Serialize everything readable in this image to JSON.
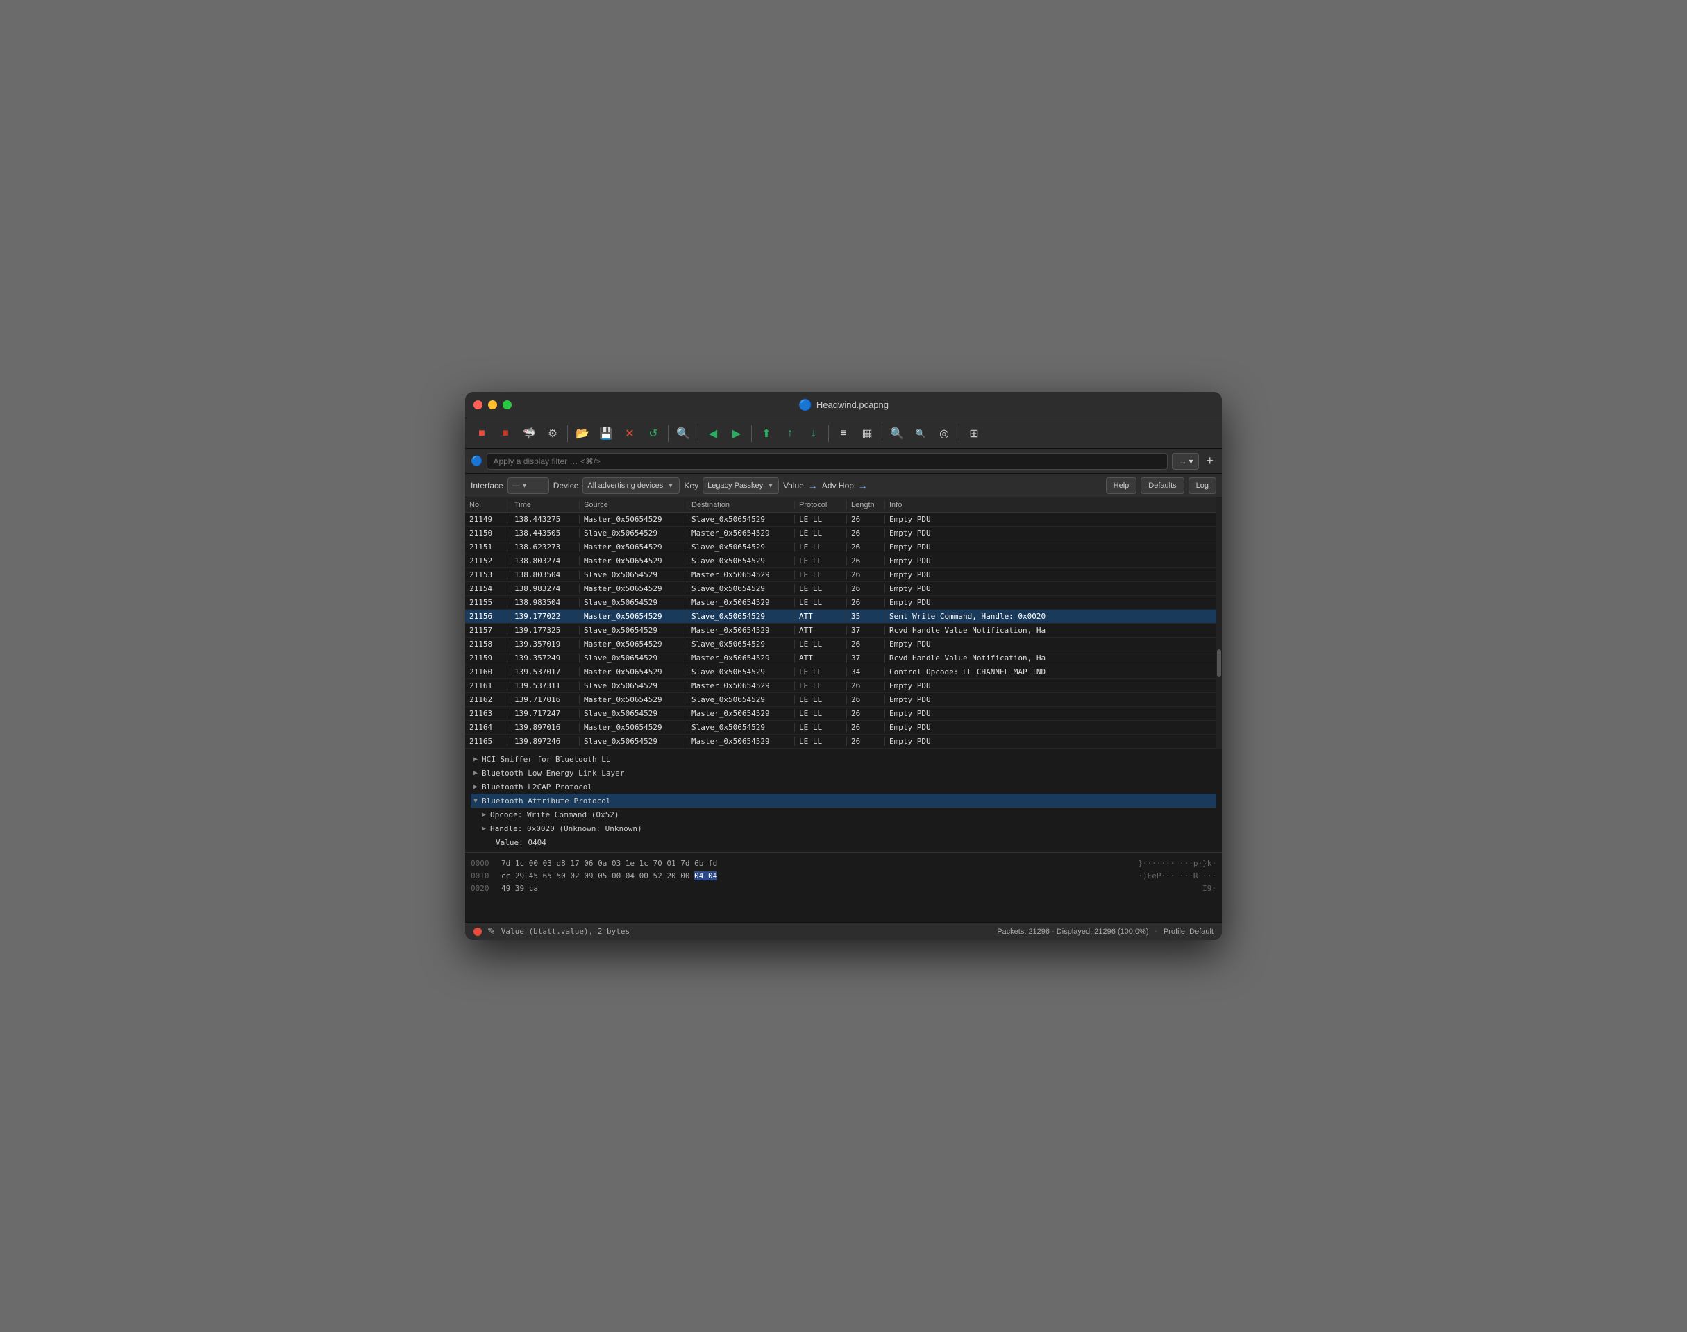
{
  "window": {
    "title": "Headwind.pcapng",
    "title_icon": "🔵"
  },
  "toolbar": {
    "buttons": [
      {
        "name": "stop-capture",
        "icon": "■",
        "class": "stop"
      },
      {
        "name": "start-capture",
        "icon": "▶",
        "class": "green"
      },
      {
        "name": "settings",
        "icon": "⚙",
        "class": ""
      },
      {
        "name": "open-file",
        "icon": "📁",
        "class": "blue"
      },
      {
        "name": "save",
        "icon": "💾",
        "class": ""
      },
      {
        "name": "close",
        "icon": "✕",
        "class": ""
      },
      {
        "name": "reload",
        "icon": "↺",
        "class": ""
      },
      {
        "name": "zoom-in-pkt",
        "icon": "🔍+",
        "class": ""
      },
      {
        "name": "prev",
        "icon": "◀",
        "class": "green"
      },
      {
        "name": "next",
        "icon": "▶",
        "class": "green"
      },
      {
        "name": "go-first",
        "icon": "⏫",
        "class": ""
      },
      {
        "name": "go-up",
        "icon": "⬆",
        "class": "green"
      },
      {
        "name": "go-down",
        "icon": "⬇",
        "class": "green"
      },
      {
        "name": "list-view",
        "icon": "≡",
        "class": ""
      },
      {
        "name": "columns",
        "icon": "⊞",
        "class": ""
      },
      {
        "name": "zoom-in",
        "icon": "+🔍",
        "class": ""
      },
      {
        "name": "zoom-out",
        "icon": "🔍-",
        "class": ""
      },
      {
        "name": "zoom-reset",
        "icon": "◎",
        "class": ""
      },
      {
        "name": "stats",
        "icon": "▦",
        "class": ""
      }
    ]
  },
  "filterbar": {
    "placeholder": "Apply a display filter … <⌘/>",
    "arrow_btn": "→",
    "dropdown_arrow": "▾"
  },
  "proto_toolbar": {
    "interface_label": "Interface",
    "device_label": "Device",
    "device_dropdown": "All advertising devices",
    "key_label": "Key",
    "key_dropdown": "Legacy Passkey",
    "value_label": "Value",
    "value_arrow": "→",
    "adv_hop_label": "Adv Hop",
    "adv_hop_arrow": "→",
    "help_btn": "Help",
    "defaults_btn": "Defaults",
    "log_btn": "Log"
  },
  "packet_table": {
    "headers": [
      "No.",
      "Time",
      "Source",
      "Destination",
      "Protocol",
      "Length",
      "Info"
    ],
    "rows": [
      {
        "no": "21149",
        "time": "138.443275",
        "src": "Master_0x50654529",
        "dst": "Slave_0x50654529",
        "proto": "LE LL",
        "len": "26",
        "info": "Empty PDU",
        "selected": false
      },
      {
        "no": "21150",
        "time": "138.443505",
        "src": "Slave_0x50654529",
        "dst": "Master_0x50654529",
        "proto": "LE LL",
        "len": "26",
        "info": "Empty PDU",
        "selected": false
      },
      {
        "no": "21151",
        "time": "138.623273",
        "src": "Master_0x50654529",
        "dst": "Slave_0x50654529",
        "proto": "LE LL",
        "len": "26",
        "info": "Empty PDU",
        "selected": false
      },
      {
        "no": "21152",
        "time": "138.803274",
        "src": "Master_0x50654529",
        "dst": "Slave_0x50654529",
        "proto": "LE LL",
        "len": "26",
        "info": "Empty PDU",
        "selected": false
      },
      {
        "no": "21153",
        "time": "138.803504",
        "src": "Slave_0x50654529",
        "dst": "Master_0x50654529",
        "proto": "LE LL",
        "len": "26",
        "info": "Empty PDU",
        "selected": false
      },
      {
        "no": "21154",
        "time": "138.983274",
        "src": "Master_0x50654529",
        "dst": "Slave_0x50654529",
        "proto": "LE LL",
        "len": "26",
        "info": "Empty PDU",
        "selected": false
      },
      {
        "no": "21155",
        "time": "138.983504",
        "src": "Slave_0x50654529",
        "dst": "Master_0x50654529",
        "proto": "LE LL",
        "len": "26",
        "info": "Empty PDU",
        "selected": false
      },
      {
        "no": "21156",
        "time": "139.177022",
        "src": "Master_0x50654529",
        "dst": "Slave_0x50654529",
        "proto": "ATT",
        "len": "35",
        "info": "Sent Write Command, Handle: 0x0020",
        "selected": true,
        "att": true
      },
      {
        "no": "21157",
        "time": "139.177325",
        "src": "Slave_0x50654529",
        "dst": "Master_0x50654529",
        "proto": "ATT",
        "len": "37",
        "info": "Rcvd Handle Value Notification, Ha",
        "selected": false
      },
      {
        "no": "21158",
        "time": "139.357019",
        "src": "Master_0x50654529",
        "dst": "Slave_0x50654529",
        "proto": "LE LL",
        "len": "26",
        "info": "Empty PDU",
        "selected": false
      },
      {
        "no": "21159",
        "time": "139.357249",
        "src": "Slave_0x50654529",
        "dst": "Master_0x50654529",
        "proto": "ATT",
        "len": "37",
        "info": "Rcvd Handle Value Notification, Ha",
        "selected": false
      },
      {
        "no": "21160",
        "time": "139.537017",
        "src": "Master_0x50654529",
        "dst": "Slave_0x50654529",
        "proto": "LE LL",
        "len": "34",
        "info": "Control Opcode: LL_CHANNEL_MAP_IND",
        "selected": false
      },
      {
        "no": "21161",
        "time": "139.537311",
        "src": "Slave_0x50654529",
        "dst": "Master_0x50654529",
        "proto": "LE LL",
        "len": "26",
        "info": "Empty PDU",
        "selected": false
      },
      {
        "no": "21162",
        "time": "139.717016",
        "src": "Master_0x50654529",
        "dst": "Slave_0x50654529",
        "proto": "LE LL",
        "len": "26",
        "info": "Empty PDU",
        "selected": false
      },
      {
        "no": "21163",
        "time": "139.717247",
        "src": "Slave_0x50654529",
        "dst": "Master_0x50654529",
        "proto": "LE LL",
        "len": "26",
        "info": "Empty PDU",
        "selected": false
      },
      {
        "no": "21164",
        "time": "139.897016",
        "src": "Master_0x50654529",
        "dst": "Slave_0x50654529",
        "proto": "LE LL",
        "len": "26",
        "info": "Empty PDU",
        "selected": false
      },
      {
        "no": "21165",
        "time": "139.897246",
        "src": "Slave_0x50654529",
        "dst": "Master_0x50654529",
        "proto": "LE LL",
        "len": "26",
        "info": "Empty PDU",
        "selected": false
      }
    ]
  },
  "detail_pane": {
    "items": [
      {
        "indent": 0,
        "open": true,
        "chevron": "▶",
        "text": "HCI Sniffer for Bluetooth LL"
      },
      {
        "indent": 0,
        "open": false,
        "chevron": "▶",
        "text": "Bluetooth Low Energy Link Layer"
      },
      {
        "indent": 0,
        "open": false,
        "chevron": "▶",
        "text": "Bluetooth L2CAP Protocol"
      },
      {
        "indent": 0,
        "open": true,
        "chevron": "▼",
        "text": "Bluetooth Attribute Protocol"
      },
      {
        "indent": 1,
        "open": false,
        "chevron": "▶",
        "text": "Opcode: Write Command (0x52)"
      },
      {
        "indent": 1,
        "open": false,
        "chevron": "▶",
        "text": "Handle: 0x0020 (Unknown: Unknown)"
      },
      {
        "indent": 1,
        "open": false,
        "chevron": null,
        "text": "Value: 0404"
      }
    ]
  },
  "hex_pane": {
    "rows": [
      {
        "offset": "0000",
        "bytes": "7d 1c 00 03 d8 17 06 0a  03 1e 1c 70 01 7d 6b fd",
        "ascii": "}·······  ···p·}k·"
      },
      {
        "offset": "0010",
        "bytes": "cc 29 45 65 50 02 09 05  00 04 00 52 20 00 04 04",
        "ascii": "·)EeP···  ···R ···",
        "highlight": [
          12,
          13
        ]
      },
      {
        "offset": "0020",
        "bytes": "49 39 ca",
        "ascii": "I9·"
      }
    ]
  },
  "statusbar": {
    "field_text": "Value (btatt.value), 2 bytes",
    "packets_text": "Packets: 21296 · Displayed: 21296 (100.0%)",
    "profile_text": "Profile: Default"
  }
}
